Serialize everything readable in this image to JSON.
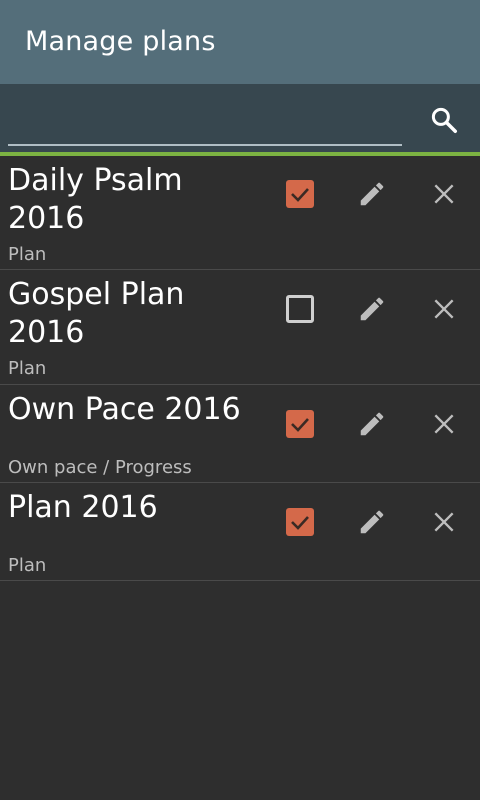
{
  "app_bar": {
    "title": "Manage plans"
  },
  "search": {
    "placeholder": "",
    "value": ""
  },
  "colors": {
    "app_bar": "#546e7a",
    "search_bar": "#37474f",
    "accent": "#7cb342",
    "checkbox_checked": "#d4694a",
    "background": "#2e2e2e"
  },
  "plans": [
    {
      "title": "Daily Psalm 2016",
      "subtitle": "Plan",
      "checked": true
    },
    {
      "title": "Gospel Plan 2016",
      "subtitle": "Plan",
      "checked": false
    },
    {
      "title": "Own Pace 2016",
      "subtitle": "Own pace / Progress",
      "checked": true
    },
    {
      "title": "Plan 2016",
      "subtitle": "Plan",
      "checked": true
    }
  ],
  "icons": {
    "search": "search-icon",
    "edit": "pencil-icon",
    "delete": "close-icon",
    "checkbox": "checkbox-icon"
  }
}
